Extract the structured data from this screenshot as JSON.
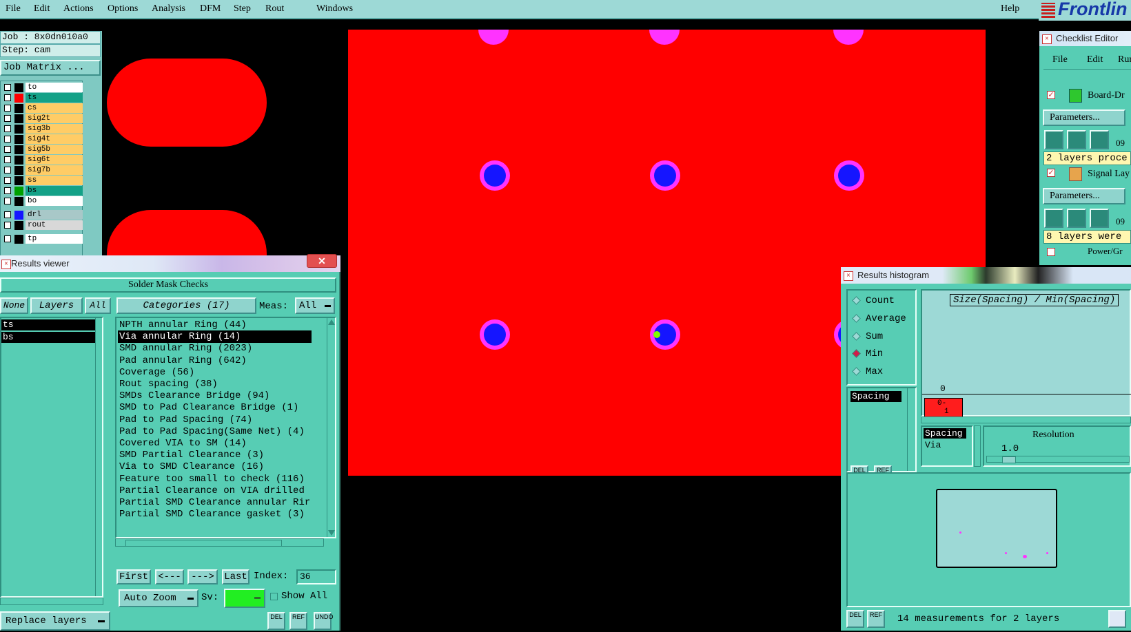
{
  "menu": {
    "items": [
      "File",
      "Edit",
      "Actions",
      "Options",
      "Analysis",
      "DFM",
      "Step",
      "Rout",
      "Windows"
    ],
    "help": "Help",
    "brand": "Frontlin"
  },
  "job": {
    "job_line": "Job : 8x0dn010a0",
    "step_line": "Step: cam",
    "matrix_button": "Job Matrix ...",
    "layers": [
      {
        "name": "to",
        "swatch": "#000000",
        "bg": "#ffffff"
      },
      {
        "name": "ts",
        "swatch": "#ff0000",
        "bg": "#14a187"
      },
      {
        "name": "cs",
        "swatch": "#000000",
        "bg": "#ffcc66"
      },
      {
        "name": "sig2t",
        "swatch": "#000000",
        "bg": "#ffcc66"
      },
      {
        "name": "sig3b",
        "swatch": "#000000",
        "bg": "#ffcc66"
      },
      {
        "name": "sig4t",
        "swatch": "#000000",
        "bg": "#ffcc66"
      },
      {
        "name": "sig5b",
        "swatch": "#000000",
        "bg": "#ffcc66"
      },
      {
        "name": "sig6t",
        "swatch": "#000000",
        "bg": "#ffcc66"
      },
      {
        "name": "sig7b",
        "swatch": "#000000",
        "bg": "#ffcc66"
      },
      {
        "name": "ss",
        "swatch": "#000000",
        "bg": "#ffcc66"
      },
      {
        "name": "bs",
        "swatch": "#00a000",
        "bg": "#14a187"
      },
      {
        "name": "bo",
        "swatch": "#000000",
        "bg": "#ffffff"
      },
      {
        "name": "drl",
        "swatch": "#1515ff",
        "bg": "#a8c8c8"
      },
      {
        "name": "rout",
        "swatch": "#000000",
        "bg": "#d8d8d8"
      },
      {
        "name": "tp",
        "swatch": "#000000",
        "bg": "#ffffff"
      }
    ]
  },
  "results_viewer": {
    "window_title": "Results viewer",
    "header": "Solder Mask Checks",
    "none_button": "None",
    "layers_button": "Layers",
    "all_button": "All",
    "categories_button": "Categories (17)",
    "meas_label": "Meas:",
    "meas_value": "All",
    "layers_list": [
      "ts",
      "bs"
    ],
    "categories": [
      "NPTH annular Ring (44)",
      "Via annular Ring (14)",
      "SMD annular Ring (2023)",
      "Pad annular Ring (642)",
      "Coverage (56)",
      "Rout spacing (38)",
      "SMDs Clearance Bridge (94)",
      "SMD to Pad Clearance Bridge (1)",
      "Pad to Pad Spacing (74)",
      "Pad to Pad Spacing(Same Net) (4)",
      "Covered VIA to SM (14)",
      "SMD Partial Clearance (3)",
      "Via to SMD Clearance (16)",
      "Feature too small to check (116)",
      "Partial Clearance on VIA drilled",
      "Partial SMD Clearance annular Rir",
      "Partial SMD Clearance gasket (3)"
    ],
    "selected_category_index": 1,
    "first_button": "First",
    "prev_button": "<---",
    "next_button": "--->",
    "last_button": "Last",
    "index_label": "Index:",
    "index_value": "36",
    "auto_zoom": "Auto Zoom",
    "sv_label": "Sv:",
    "show_all": "Show All",
    "replace_layers": "Replace layers",
    "del": "DEL",
    "ref": "REF",
    "undo": "UNDO"
  },
  "checklist_editor": {
    "window_title": "Checklist Editor",
    "menu": [
      "File",
      "Edit",
      "Run"
    ],
    "item1_name": "Board-Dr",
    "params1": "Parameters...",
    "item1_num": "09",
    "status1": "2 layers proce",
    "item2_name": "Signal Lay",
    "params2": "Parameters...",
    "item2_num": "09",
    "status2": "8 layers were",
    "item3_name": "Power/Gr"
  },
  "histogram": {
    "window_title": "Results histogram",
    "modes": [
      "Count",
      "Average",
      "Sum",
      "Min",
      "Max"
    ],
    "selected_mode": "Min",
    "chart_title": "Size(Spacing) / Min(Spacing)",
    "axis_top": "0",
    "bar_label": "0-",
    "bar_sub": "1",
    "list_item": "Spacing",
    "list2": [
      "Spacing",
      "Via"
    ],
    "resolution_label": "Resolution",
    "resolution_value": "1.0",
    "status": "14 measurements for 2 layers",
    "del": "DEL",
    "ref": "REF"
  },
  "colors": {
    "board_red": "#ff0000",
    "pad_blue": "#1515ff",
    "ring_magenta": "#ff33ff",
    "panel_teal": "#57cdb4",
    "menubar": "#9dd9d6"
  }
}
